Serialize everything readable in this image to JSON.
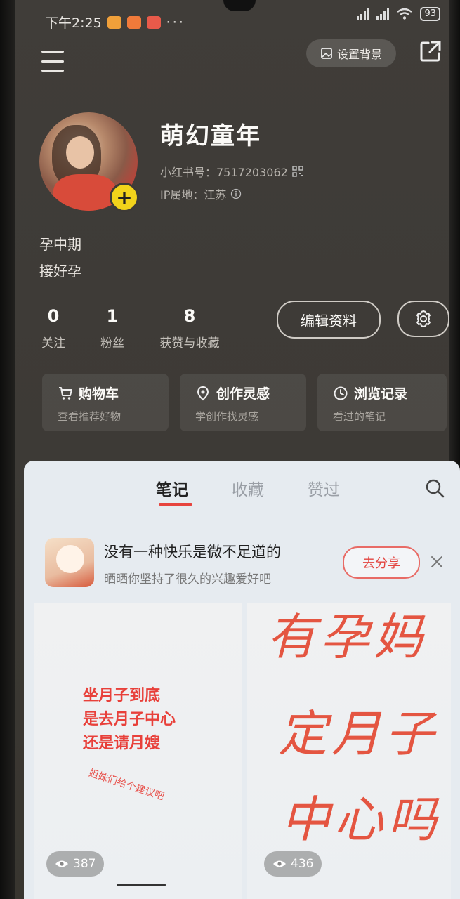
{
  "status_bar": {
    "time": "下午2:25",
    "battery": "93"
  },
  "header": {
    "bg_button": "设置背景"
  },
  "profile": {
    "nickname": "萌幻童年",
    "id_line": "小红书号：7517203062",
    "ip_line": "IP属地：江苏",
    "bio_1": "孕中期",
    "bio_2": "接好孕"
  },
  "stats": [
    {
      "num": "0",
      "label": "关注"
    },
    {
      "num": "1",
      "label": "粉丝"
    },
    {
      "num": "8",
      "label": "获赞与收藏"
    }
  ],
  "edit_label": "编辑资料",
  "cards": [
    {
      "title": "购物车",
      "sub": "查看推荐好物",
      "icon": "cart-icon"
    },
    {
      "title": "创作灵感",
      "sub": "学创作找灵感",
      "icon": "location-pin-icon"
    },
    {
      "title": "浏览记录",
      "sub": "看过的笔记",
      "icon": "clock-icon"
    }
  ],
  "tabs": [
    "笔记",
    "收藏",
    "赞过"
  ],
  "promo": {
    "title": "没有一种快乐是微不足道的",
    "sub": "晒晒你坚持了很久的兴趣爱好吧",
    "button": "去分享"
  },
  "notes": [
    {
      "lines": [
        "坐月子到底",
        "是去月子中心",
        "还是请月嫂"
      ],
      "slant": "姐妹们给个建议吧",
      "views": "387"
    },
    {
      "handwriting": [
        "有孕妈",
        "定月子",
        "中心吗"
      ],
      "views": "436"
    }
  ],
  "colors": {
    "accent": "#e7443e",
    "badge": "#f2d31b"
  }
}
